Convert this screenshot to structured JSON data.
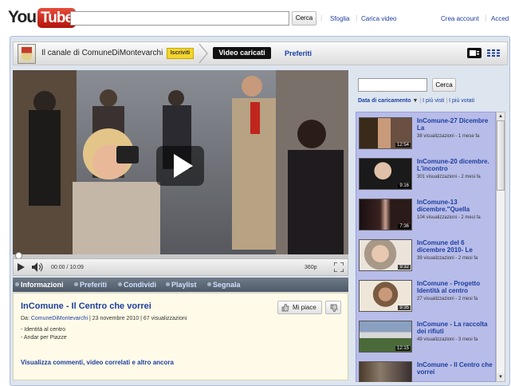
{
  "header": {
    "logo_you": "You",
    "logo_tube": "Tube",
    "search_button": "Cerca",
    "links": [
      "Sfoglia",
      "Carica video"
    ],
    "account_links": [
      "Crea account",
      "Acced"
    ]
  },
  "channel": {
    "name": "Il canale di ComuneDiMontevarchi",
    "subscribe": "Iscriviti",
    "tabs": [
      "Video caricati",
      "Preferiti"
    ]
  },
  "player": {
    "time": "00:00 / 10:09",
    "quality": "360p",
    "progress_fraction": 0
  },
  "info_tabs": [
    "Informazioni",
    "Preferiti",
    "Condividi",
    "Playlist",
    "Segnala"
  ],
  "video": {
    "title": "InComune - Il Centro che vorrei",
    "meta_prefix": "Da: ",
    "author": "ComuneDiMontevarchi",
    "meta_rest": " | 23 novembre 2010 | 67 visualizzazioni",
    "desc_line1": "- Identità al centro",
    "desc_line2": "- Andar per Piazze",
    "like": "Mi piace",
    "more": "Visualizza commenti, video correlati e altro ancora"
  },
  "sidebar": {
    "search_button": "Cerca",
    "sort_active": "Data di caricamento",
    "sort_other1": "I più visti",
    "sort_other2": "I più votati",
    "items": [
      {
        "title": "InComune-27 Dicembre La",
        "meta": "38 visualizzazioni - 1 mese fa",
        "duration": "12:54"
      },
      {
        "title": "InComune-20 dicembre. L'incontro",
        "meta": "301 visualizzazioni - 2 mesi fa",
        "duration": "9:16"
      },
      {
        "title": "InComune-13 dicembre.\"Quella",
        "meta": "104 visualizzazioni - 2 mesi fa",
        "duration": "7:36"
      },
      {
        "title": "InComune del 6 dicembre 2010- Le",
        "meta": "39 visualizzazioni - 2 mesi fa",
        "duration": "9:32"
      },
      {
        "title": "InComune - Progetto Identità al centro",
        "meta": "27 visualizzazioni - 2 mesi fa",
        "duration": "9:35"
      },
      {
        "title": "InComune - La raccolta dei rifiuti",
        "meta": "49 visualizzazioni - 3 mesi fa",
        "duration": "12:15"
      },
      {
        "title": "InComune - Il Centro che vorrei",
        "meta": "",
        "duration": ""
      }
    ]
  }
}
